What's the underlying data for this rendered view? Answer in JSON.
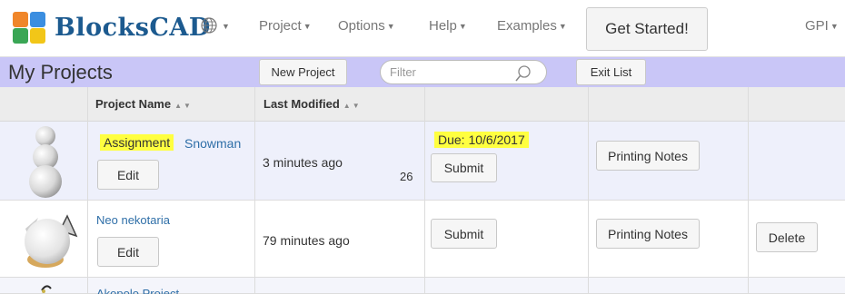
{
  "brand": {
    "name": "BlocksCAD"
  },
  "nav": {
    "language_icon": "globe-icon",
    "items": [
      {
        "label": "Project"
      },
      {
        "label": "Options"
      },
      {
        "label": "Help"
      },
      {
        "label": "Examples"
      }
    ],
    "get_started": "Get Started!",
    "user": "GPI"
  },
  "toolbar": {
    "title": "My Projects",
    "new_project": "New Project",
    "filter_placeholder": "Filter",
    "exit_list": "Exit List"
  },
  "table": {
    "columns": [
      "Project Name",
      "Last Modified"
    ],
    "rows": [
      {
        "badge": "Assignment",
        "name": "Snowman",
        "edit": "Edit",
        "modified": "3 minutes ago",
        "count": "26",
        "due": "Due: 10/6/2017",
        "submit": "Submit",
        "printing": "Printing Notes"
      },
      {
        "name": "Neo nekotaria",
        "edit": "Edit",
        "modified": "79 minutes ago",
        "submit": "Submit",
        "printing": "Printing Notes",
        "delete": "Delete"
      },
      {
        "name": "Akopolo Project"
      }
    ]
  },
  "colors": {
    "brand": "#1c5a8f",
    "header_bar": "#c9c6f7",
    "highlight": "#ffff40",
    "link": "#2f6fa8"
  }
}
